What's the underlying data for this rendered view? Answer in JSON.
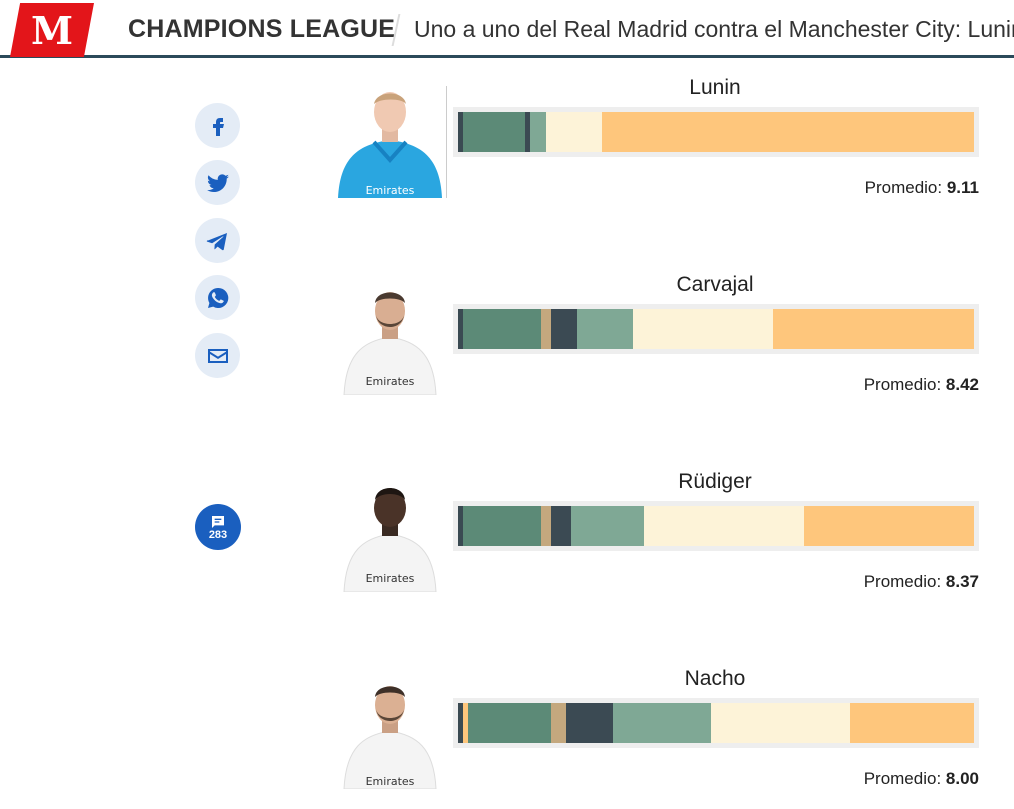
{
  "header": {
    "logo_letter": "M",
    "section": "CHAMPIONS LEAGUE",
    "headline": "Uno a uno del Real Madrid contra el Manchester City: Lunin"
  },
  "share": {
    "icons": [
      "facebook-icon",
      "twitter-icon",
      "telegram-icon",
      "whatsapp-icon",
      "email-icon"
    ],
    "comments_count": "283"
  },
  "colors": {
    "accent_blue": "#1a5fbf",
    "brand_red": "#e3151a",
    "rating_scale": [
      "#3a4a52",
      "#5c8a77",
      "#c4a87e",
      "#3b4a53",
      "#7fa895",
      "#fdf3d8",
      "#fec67c"
    ]
  },
  "average_label": "Promedio:",
  "players": [
    {
      "name": "Lunin",
      "average": "9.11",
      "kit": "goalkeeper",
      "distribution": [
        {
          "color": "#3a4a52",
          "share": 1.0
        },
        {
          "color": "#5c8a77",
          "share": 12.0
        },
        {
          "color": "#3b4a53",
          "share": 1.0
        },
        {
          "color": "#7fa895",
          "share": 3.0
        },
        {
          "color": "#fdf3d8",
          "share": 11.0
        },
        {
          "color": "#fec67c",
          "share": 72.0
        }
      ]
    },
    {
      "name": "Carvajal",
      "average": "8.42",
      "kit": "outfield",
      "distribution": [
        {
          "color": "#3a4a52",
          "share": 1.0
        },
        {
          "color": "#5c8a77",
          "share": 15.0
        },
        {
          "color": "#c4a87e",
          "share": 2.0
        },
        {
          "color": "#3b4a53",
          "share": 5.0
        },
        {
          "color": "#7fa895",
          "share": 11.0
        },
        {
          "color": "#fdf3d8",
          "share": 27.0
        },
        {
          "color": "#fec67c",
          "share": 39.0
        }
      ]
    },
    {
      "name": "Rüdiger",
      "average": "8.37",
      "kit": "outfield-dark",
      "distribution": [
        {
          "color": "#3a4a52",
          "share": 1.0
        },
        {
          "color": "#5c8a77",
          "share": 15.0
        },
        {
          "color": "#c4a87e",
          "share": 2.0
        },
        {
          "color": "#3b4a53",
          "share": 4.0
        },
        {
          "color": "#7fa895",
          "share": 14.0
        },
        {
          "color": "#fdf3d8",
          "share": 31.0
        },
        {
          "color": "#fec67c",
          "share": 33.0
        }
      ]
    },
    {
      "name": "Nacho",
      "average": "8.00",
      "kit": "outfield",
      "distribution": [
        {
          "color": "#3a4a52",
          "share": 1.0
        },
        {
          "color": "#fec67c",
          "share": 1.0
        },
        {
          "color": "#5c8a77",
          "share": 16.0
        },
        {
          "color": "#c4a87e",
          "share": 3.0
        },
        {
          "color": "#3b4a53",
          "share": 9.0
        },
        {
          "color": "#7fa895",
          "share": 19.0
        },
        {
          "color": "#fdf3d8",
          "share": 27.0
        },
        {
          "color": "#fec67c",
          "share": 24.0
        }
      ]
    }
  ]
}
